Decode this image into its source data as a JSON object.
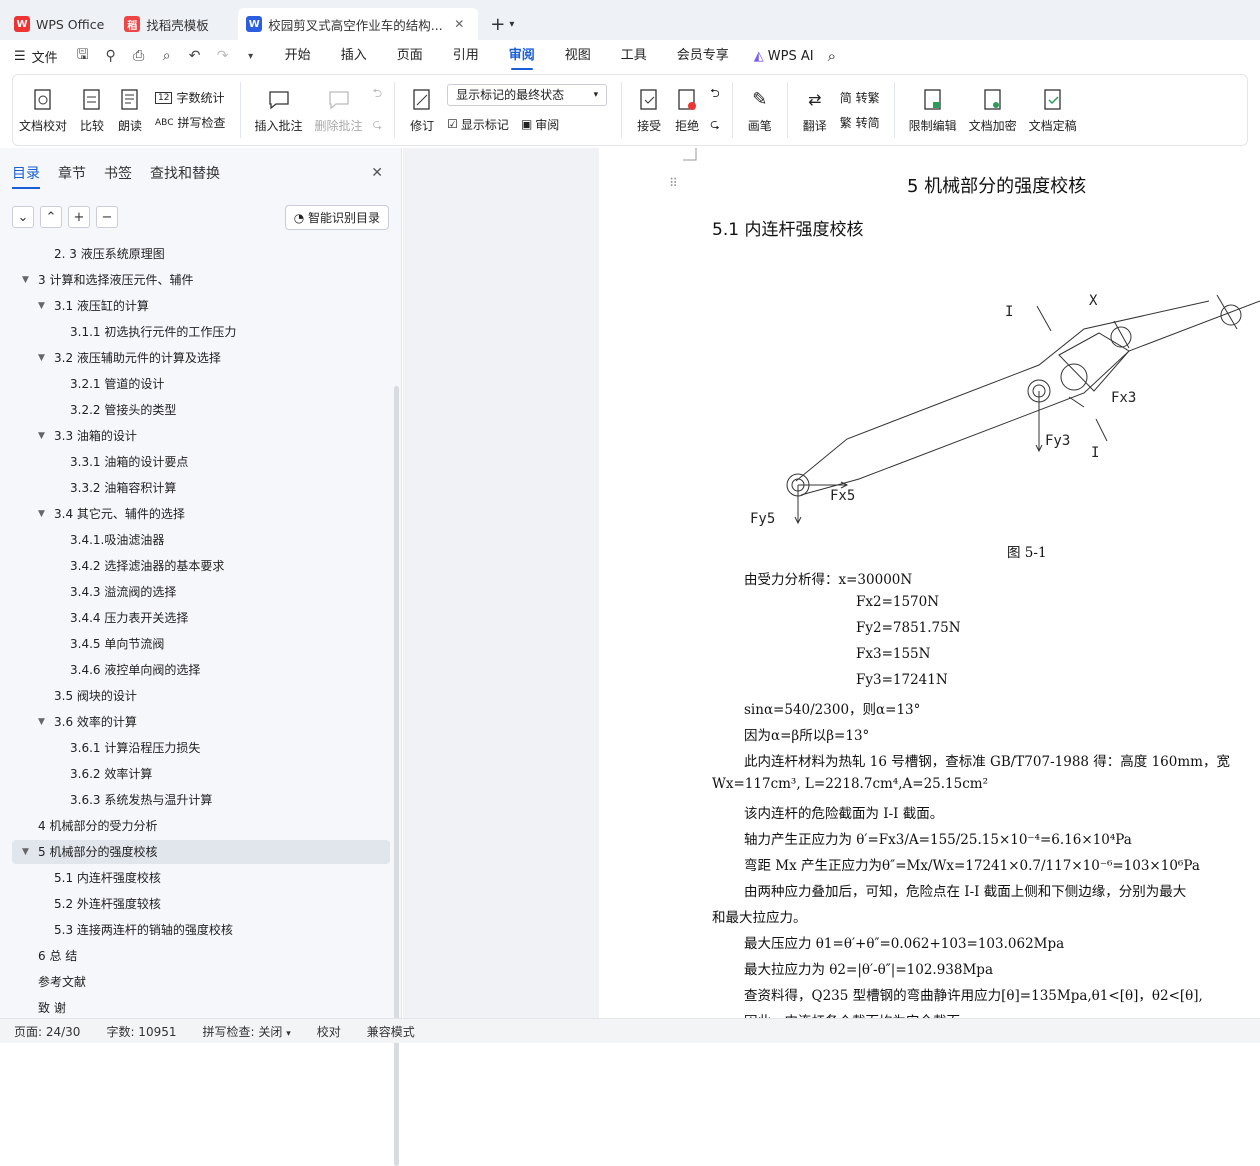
{
  "tabs": [
    {
      "label": "WPS Office"
    },
    {
      "label": "找稻壳模板"
    },
    {
      "label": "校园剪叉式高空作业车的结构..."
    }
  ],
  "menu": {
    "file": "文件",
    "tabs": [
      "开始",
      "插入",
      "页面",
      "引用",
      "审阅",
      "视图",
      "工具",
      "会员专享"
    ],
    "ai": "WPS AI"
  },
  "ribbon": {
    "doc_check": "文档校对",
    "compare": "比较",
    "read": "朗读",
    "word_count": "字数统计",
    "spell_check": "拼写检查",
    "insert_comment": "插入批注",
    "delete_comment": "删除批注",
    "revise": "修订",
    "display_state": "显示标记的最终状态",
    "show_marks": "显示标记",
    "review_pane": "审阅",
    "accept": "接受",
    "reject": "拒绝",
    "pen": "画笔",
    "translate": "翻译",
    "to_traditional": "简 转繁",
    "to_simplified": "繁 转简",
    "restrict_edit": "限制编辑",
    "encrypt": "文档加密",
    "finalize": "文档定稿"
  },
  "sidebar": {
    "tabs": [
      "目录",
      "章节",
      "书签",
      "查找和替换"
    ],
    "smart_toc": "智能识别目录"
  },
  "toc": [
    {
      "label": "2. 3 液压系统原理图",
      "level": 2,
      "arrow": false
    },
    {
      "label": "3 计算和选择液压元件、辅件",
      "level": 1,
      "arrow": true
    },
    {
      "label": "3.1 液压缸的计算",
      "level": 2,
      "arrow": true
    },
    {
      "label": "3.1.1  初选执行元件的工作压力",
      "level": 3,
      "arrow": false
    },
    {
      "label": "3.2  液压辅助元件的计算及选择",
      "level": 2,
      "arrow": true
    },
    {
      "label": "3.2.1 管道的设计",
      "level": 3,
      "arrow": false
    },
    {
      "label": "3.2.2 管接头的类型",
      "level": 3,
      "arrow": false
    },
    {
      "label": "3.3 油箱的设计",
      "level": 2,
      "arrow": true
    },
    {
      "label": "3.3.1 油箱的设计要点",
      "level": 3,
      "arrow": false
    },
    {
      "label": "3.3.2 油箱容积计算",
      "level": 3,
      "arrow": false
    },
    {
      "label": "3.4    其它元、辅件的选择",
      "level": 2,
      "arrow": true
    },
    {
      "label": "3.4.1.吸油滤油器",
      "level": 3,
      "arrow": false
    },
    {
      "label": "3.4.2 选择滤油器的基本要求",
      "level": 3,
      "arrow": false
    },
    {
      "label": "3.4.3 溢流阀的选择",
      "level": 3,
      "arrow": false
    },
    {
      "label": "3.4.4 压力表开关选择",
      "level": 3,
      "arrow": false
    },
    {
      "label": "3.4.5 单向节流阀",
      "level": 3,
      "arrow": false
    },
    {
      "label": "3.4.6  液控单向阀的选择",
      "level": 3,
      "arrow": false
    },
    {
      "label": "3.5 阀块的设计",
      "level": 2,
      "arrow": false
    },
    {
      "label": "3.6  效率的计算",
      "level": 2,
      "arrow": true
    },
    {
      "label": "3.6.1 计算沿程压力损失",
      "level": 3,
      "arrow": false
    },
    {
      "label": "3.6.2 效率计算",
      "level": 3,
      "arrow": false
    },
    {
      "label": "3.6.3 系统发热与温升计算",
      "level": 3,
      "arrow": false
    },
    {
      "label": "4  机械部分的受力分析",
      "level": 1,
      "arrow": false
    },
    {
      "label": "5  机械部分的强度校核",
      "level": 1,
      "arrow": true,
      "selected": true
    },
    {
      "label": "5.1  内连杆强度校核",
      "level": 2,
      "arrow": false
    },
    {
      "label": "5.2  外连杆强度较核",
      "level": 2,
      "arrow": false
    },
    {
      "label": "5.3  连接两连杆的销轴的强度校核",
      "level": 2,
      "arrow": false
    },
    {
      "label": "6 总    结",
      "level": 1,
      "arrow": false
    },
    {
      "label": "参考文献",
      "level": 1,
      "arrow": false
    },
    {
      "label": "致    谢",
      "level": 1,
      "arrow": false
    }
  ],
  "doc": {
    "h1": "5  机械部分的强度校核",
    "h2": "5.1  内连杆强度校核",
    "fig_labels": {
      "i_top": "I",
      "x": "X",
      "fx3": "Fx3",
      "fy3": "Fy3",
      "i_bottom": "I",
      "fx5": "Fx5",
      "fy5": "Fy5"
    },
    "caption": "图 5-1",
    "lines": [
      "由受力分析得：x=30000N",
      "Fx2=1570N",
      "Fy2=7851.75N",
      "Fx3=155N",
      "Fy3=17241N",
      "sinα=540/2300，则α=13°",
      "因为α=β所以β=13°",
      "此内连杆材料为热轧 16 号槽钢，查标准 GB/T707-1988 得：高度 160mm，宽",
      "Wx=117cm³, L=2218.7cm⁴,A=25.15cm²",
      "该内连杆的危险截面为 I-I 截面。",
      "轴力产生正应力为          θ′=Fx3/A=155/25.15×10⁻⁴=6.16×10⁴Pa",
      "弯距 Mx 产生正应力为θ″=Mx/Wx=17241×0.7/117×10⁻⁶=103×10⁶Pa",
      "由两种应力叠加后，可知，危险点在 I-I 截面上侧和下侧边缘，分别为最大",
      "和最大拉应力。",
      "最大压应力      θ1=θ′+θ″=0.062+103=103.062Mpa",
      "最大拉应力为   θ2=|θ′-θ″|=102.938Mpa",
      " 查资料得，Q235 型槽钢的弯曲静许用应力[θ]=135Mpa,θ1<[θ]，θ2<[θ],",
      "因此，内连杆各个截面均为安全截面。"
    ]
  },
  "status": {
    "page": "页面: 24/30",
    "words": "字数: 10951",
    "spell": "拼写检查: 关闭",
    "proof": "校对",
    "compat": "兼容模式"
  }
}
